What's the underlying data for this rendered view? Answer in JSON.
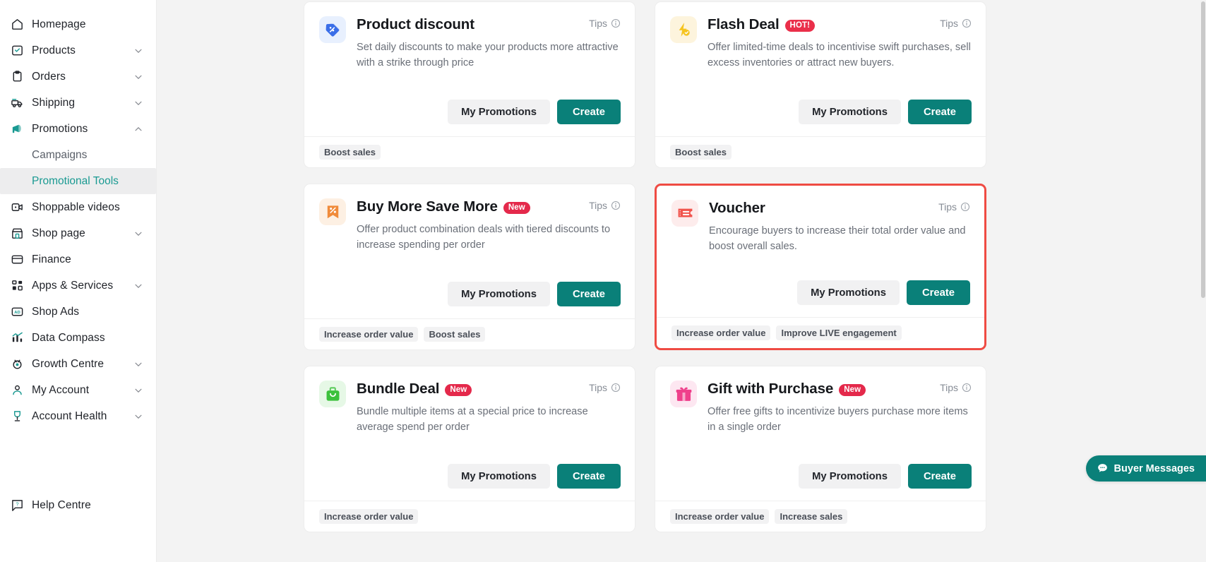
{
  "sidebar": {
    "items": [
      {
        "label": "Homepage",
        "icon": "home-icon",
        "expandable": false
      },
      {
        "label": "Products",
        "icon": "products-icon",
        "expandable": true
      },
      {
        "label": "Orders",
        "icon": "orders-icon",
        "expandable": true
      },
      {
        "label": "Shipping",
        "icon": "shipping-icon",
        "expandable": true
      },
      {
        "label": "Promotions",
        "icon": "promotions-icon",
        "expandable": true,
        "expanded": true
      }
    ],
    "sub_items": [
      {
        "label": "Campaigns",
        "active": false
      },
      {
        "label": "Promotional Tools",
        "active": true
      }
    ],
    "items_after": [
      {
        "label": "Shoppable videos",
        "icon": "video-icon",
        "expandable": false
      },
      {
        "label": "Shop page",
        "icon": "shop-page-icon",
        "expandable": true
      },
      {
        "label": "Finance",
        "icon": "finance-icon",
        "expandable": false
      },
      {
        "label": "Apps & Services",
        "icon": "apps-icon",
        "expandable": true
      },
      {
        "label": "Shop Ads",
        "icon": "shop-ads-icon",
        "expandable": false
      },
      {
        "label": "Data Compass",
        "icon": "data-compass-icon",
        "expandable": false
      },
      {
        "label": "Growth Centre",
        "icon": "growth-centre-icon",
        "expandable": true
      },
      {
        "label": "My Account",
        "icon": "my-account-icon",
        "expandable": true
      },
      {
        "label": "Account Health",
        "icon": "account-health-icon",
        "expandable": true
      }
    ],
    "help": {
      "label": "Help Centre",
      "icon": "help-icon"
    },
    "active_color": "#1a9a92"
  },
  "common": {
    "tips_label": "Tips",
    "my_promotions_label": "My Promotions",
    "create_label": "Create"
  },
  "cards": [
    {
      "title": "Product discount",
      "badge": null,
      "description": "Set daily discounts to make your products more attractive with a strike through price",
      "tips": "Tips",
      "buttons": {
        "secondary": "My Promotions",
        "primary": "Create"
      },
      "tags": [
        "Boost sales"
      ],
      "icon": "discount-tag-icon",
      "icon_bg": "#e8f0fe",
      "icon_color": "#3a6ee8",
      "highlighted": false
    },
    {
      "title": "Flash Deal",
      "badge": {
        "text": "HOT!",
        "type": "hot",
        "color": "#ea2f4a"
      },
      "description": "Offer limited-time deals to incentivise swift purchases, sell excess inventories or attract new buyers.",
      "tips": "Tips",
      "buttons": {
        "secondary": "My Promotions",
        "primary": "Create"
      },
      "tags": [
        "Boost sales"
      ],
      "icon": "flash-bolt-icon",
      "icon_bg": "#fdf4dd",
      "icon_color": "#f5c421",
      "highlighted": false
    },
    {
      "title": "Buy More Save More",
      "badge": {
        "text": "New",
        "type": "new",
        "color": "#e4294b"
      },
      "description": "Offer product combination deals with tiered discounts to increase spending per order",
      "tips": "Tips",
      "buttons": {
        "secondary": "My Promotions",
        "primary": "Create"
      },
      "tags": [
        "Increase order value",
        "Boost sales"
      ],
      "icon": "percent-ribbon-icon",
      "icon_bg": "#fdf0e3",
      "icon_color": "#f08b3a",
      "highlighted": false
    },
    {
      "title": "Voucher",
      "badge": null,
      "description": "Encourage buyers to increase their total order value and boost overall sales.",
      "tips": "Tips",
      "buttons": {
        "secondary": "My Promotions",
        "primary": "Create"
      },
      "tags": [
        "Increase order value",
        "Improve LIVE engagement"
      ],
      "icon": "voucher-ticket-icon",
      "icon_bg": "#fdecec",
      "icon_color": "#f1544d",
      "highlighted": true,
      "highlight_color": "#ef4b43"
    },
    {
      "title": "Bundle Deal",
      "badge": {
        "text": "New",
        "type": "new",
        "color": "#e4294b"
      },
      "description": "Bundle multiple items at a special price to increase average spend per order",
      "tips": "Tips",
      "buttons": {
        "secondary": "My Promotions",
        "primary": "Create"
      },
      "tags": [
        "Increase order value"
      ],
      "icon": "bundle-bag-icon",
      "icon_bg": "#e6f8e6",
      "icon_color": "#3cc13c",
      "highlighted": false
    },
    {
      "title": "Gift with Purchase",
      "badge": {
        "text": "New",
        "type": "new",
        "color": "#e4294b"
      },
      "description": "Offer free gifts to incentivize buyers purchase more items in a single order",
      "tips": "Tips",
      "buttons": {
        "secondary": "My Promotions",
        "primary": "Create"
      },
      "tags": [
        "Increase order value",
        "Increase sales"
      ],
      "icon": "gift-box-icon",
      "icon_bg": "#fde7f1",
      "icon_color": "#ef3f8b",
      "highlighted": false
    }
  ],
  "floating": {
    "buyer_messages_label": "Buyer Messages",
    "icon": "chat-bubble-icon",
    "color": "#0a8079"
  }
}
